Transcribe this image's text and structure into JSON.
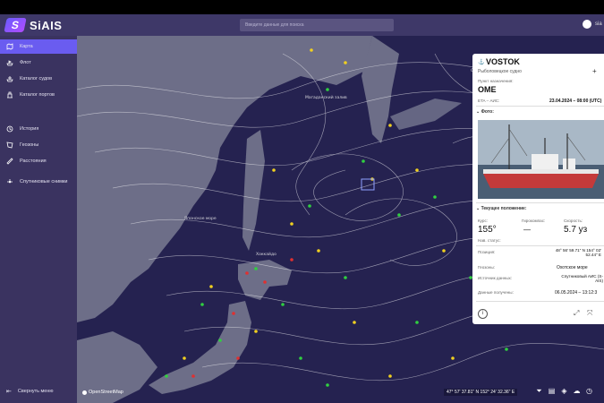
{
  "app": {
    "name": "SiAIS"
  },
  "search": {
    "placeholder": "Введите данные для поиска"
  },
  "user": {
    "name": "sia"
  },
  "sidebar": {
    "items": [
      {
        "label": "Карта",
        "icon": "map-icon"
      },
      {
        "label": "Флот",
        "icon": "fleet-icon"
      },
      {
        "label": "Каталог судов",
        "icon": "ship-catalog-icon"
      },
      {
        "label": "Каталог портов",
        "icon": "port-catalog-icon"
      },
      {
        "label": "История",
        "icon": "history-icon"
      },
      {
        "label": "Геозоны",
        "icon": "geozones-icon"
      },
      {
        "label": "Расстояния",
        "icon": "ruler-icon"
      },
      {
        "label": "Спутниковые снимки",
        "icon": "satellite-icon"
      }
    ],
    "collapse_label": "Свернуть меню"
  },
  "map": {
    "attribution": "OpenStreetMap",
    "coordinates": "47° 57' 37.81\" N 152° 24' 32.36\" E",
    "place_labels": [
      "Магаданский залив",
      "Японское море",
      "Хоккайдо",
      "Охотское море"
    ],
    "colors": {
      "sea": "#252250",
      "land": "#6d6e88",
      "wind": "#ffffff"
    }
  },
  "vessel_panel": {
    "name": "VOSTOK",
    "type": "Рыболовецкое судно",
    "destination_label": "Пункт назначения:",
    "destination": "OME",
    "eta_label": "ETA – АИС:",
    "eta": "23.04.2024 – 08:00 (UTC)",
    "photo_label": "Фото:",
    "position_section": "Текущее положение:",
    "course_label": "Курс:",
    "course": "155°",
    "gyro_label": "Гирокомпас:",
    "gyro": "—",
    "speed_label": "Скорость:",
    "speed": "5.7 уз",
    "nav_status_label": "Нав. статус:",
    "position_label": "Позиция:",
    "position": "48° 56' 59.71\" N 154° 02' 52.44\" E",
    "geozones_label": "Геозоны:",
    "geozones": "Охотское море",
    "source_label": "Источник данных:",
    "source": "Спутниковый АИС (S-AIS)",
    "received_label": "Данные получены:",
    "received": "06.05.2024 – 13:12:3"
  }
}
